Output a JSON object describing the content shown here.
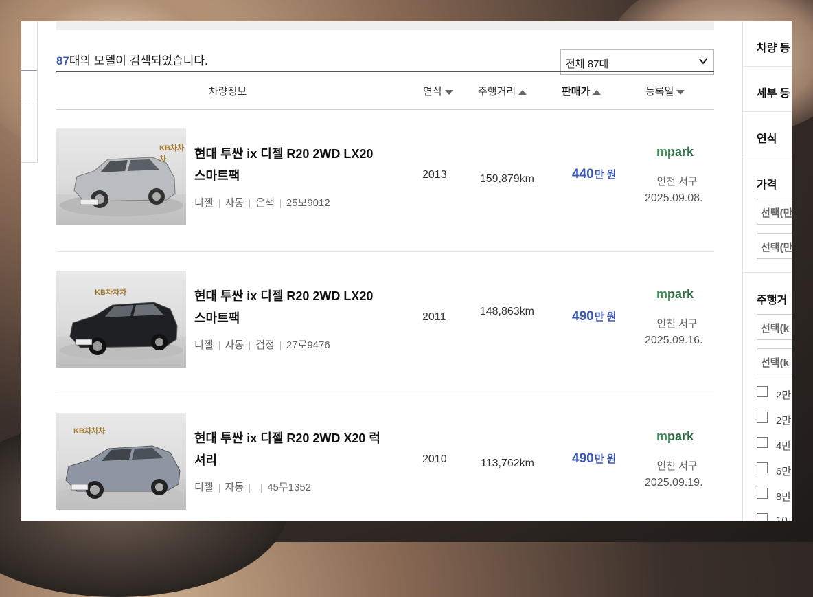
{
  "summary": {
    "count": "87",
    "text": "대의 모델이 검색되었습니다."
  },
  "select": {
    "value": "전체 87대"
  },
  "columns": {
    "info": "차량정보",
    "year": "연식",
    "mileage": "주행거리",
    "price": "판매가",
    "date": "등록일"
  },
  "cars": [
    {
      "title_line1": "현대 투싼 ix 디젤 R20 2WD LX20",
      "title_line2": "스마트팩",
      "fuel": "디젤",
      "trans": "자동",
      "color": "은색",
      "plate": "25모9012",
      "year": "2013",
      "mileage": "159,879km",
      "price": "440",
      "price_unit": "만 원",
      "dealer_prefix": "m",
      "dealer_name": "park",
      "location": "인천 서구",
      "date": "2025.09.08."
    },
    {
      "title_line1": "현대 투싼 ix 디젤 R20 2WD LX20",
      "title_line2": "스마트팩",
      "fuel": "디젤",
      "trans": "자동",
      "color": "검정",
      "plate": "27로9476",
      "year": "2011",
      "mileage": "148,863km",
      "price": "490",
      "price_unit": "만 원",
      "dealer_prefix": "m",
      "dealer_name": "park",
      "location": "인천 서구",
      "date": "2025.09.16."
    },
    {
      "title_line1": "현대 투싼 ix 디젤 R20 2WD X20 럭",
      "title_line2": "셔리",
      "fuel": "디젤",
      "trans": "자동",
      "color": "",
      "plate": "45무1352",
      "year": "2010",
      "mileage": "113,762km",
      "price": "490",
      "price_unit": "만 원",
      "dealer_prefix": "m",
      "dealer_name": "park",
      "location": "인천 서구",
      "date": "2025.09.19."
    }
  ],
  "thumb_logo": "KB차차차",
  "sidebar": {
    "item1": "차량 등",
    "item2": "세부 등",
    "item3": "연식",
    "price_label": "가격",
    "price_min": "선택(만",
    "price_max": "선택(만",
    "mileage_label": "주행거",
    "mileage_min": "선택(k",
    "mileage_max": "선택(k",
    "checks": [
      "2만",
      "2만",
      "4만",
      "6만",
      "8만",
      "10"
    ]
  },
  "colors": {
    "accent": "#3a57b4",
    "dealer": "#3f8f5a"
  }
}
